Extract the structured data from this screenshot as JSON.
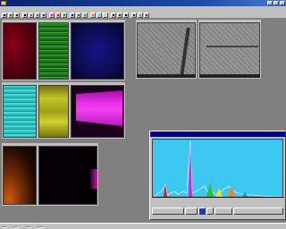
{
  "app": {
    "title": ""
  },
  "status": {
    "cells": [
      "",
      "",
      "",
      ""
    ]
  },
  "spectrum": {
    "title": "",
    "buttons": [
      "",
      "",
      "",
      "",
      "",
      ""
    ]
  },
  "colors": {
    "desktop": "#808080",
    "titlebar": "#08246b",
    "spectrum_bg": "#3cc8f0",
    "map_red": "#7a0010",
    "map_green": "#2f9a28",
    "map_blue": "#101078",
    "map_cyan": "#38c8c8",
    "map_yellow": "#b8b820",
    "map_magenta": "#e020e0",
    "map_orange": "#c06010"
  },
  "icons": [
    "app-icon",
    "minimize-icon",
    "maximize-icon",
    "close-icon"
  ]
}
